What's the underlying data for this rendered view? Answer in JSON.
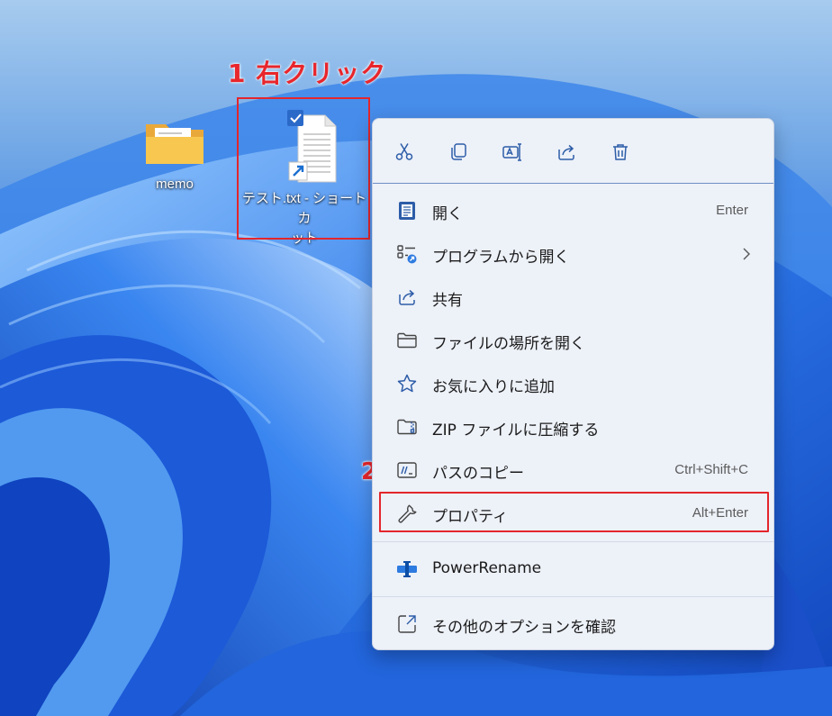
{
  "desktop": {
    "folder_label": "memo",
    "file_label_line1": "テスト.txt - ショートカ",
    "file_label_line2": "ット"
  },
  "annotations": {
    "step1": "1 右クリック",
    "step2": "2"
  },
  "context_menu": {
    "toolbar": [
      "cut-icon",
      "copy-icon",
      "rename-icon",
      "share-icon",
      "delete-icon"
    ],
    "items": [
      {
        "label": "開く",
        "shortcut": "Enter",
        "icon": "notepad-icon"
      },
      {
        "label": "プログラムから開く",
        "shortcut": "",
        "icon": "open-with-icon"
      },
      {
        "label": "共有",
        "shortcut": "",
        "icon": "share-icon"
      },
      {
        "label": "ファイルの場所を開く",
        "shortcut": "",
        "icon": "folder-icon"
      },
      {
        "label": "お気に入りに追加",
        "shortcut": "",
        "icon": "star-icon"
      },
      {
        "label": "ZIP ファイルに圧縮する",
        "shortcut": "",
        "icon": "zip-icon"
      },
      {
        "label": "パスのコピー",
        "shortcut": "Ctrl+Shift+C",
        "icon": "copy-path-icon"
      },
      {
        "label": "プロパティ",
        "shortcut": "Alt+Enter",
        "icon": "wrench-icon"
      },
      {
        "label": "PowerRename",
        "shortcut": "",
        "icon": "powerrename-icon"
      },
      {
        "label": "その他のオプションを確認",
        "shortcut": "",
        "icon": "more-options-icon"
      }
    ]
  },
  "colors": {
    "wallpaper_base": "#1f5fd6",
    "annotation_red": "#e3262c",
    "menu_bg": "#edf1f8"
  }
}
